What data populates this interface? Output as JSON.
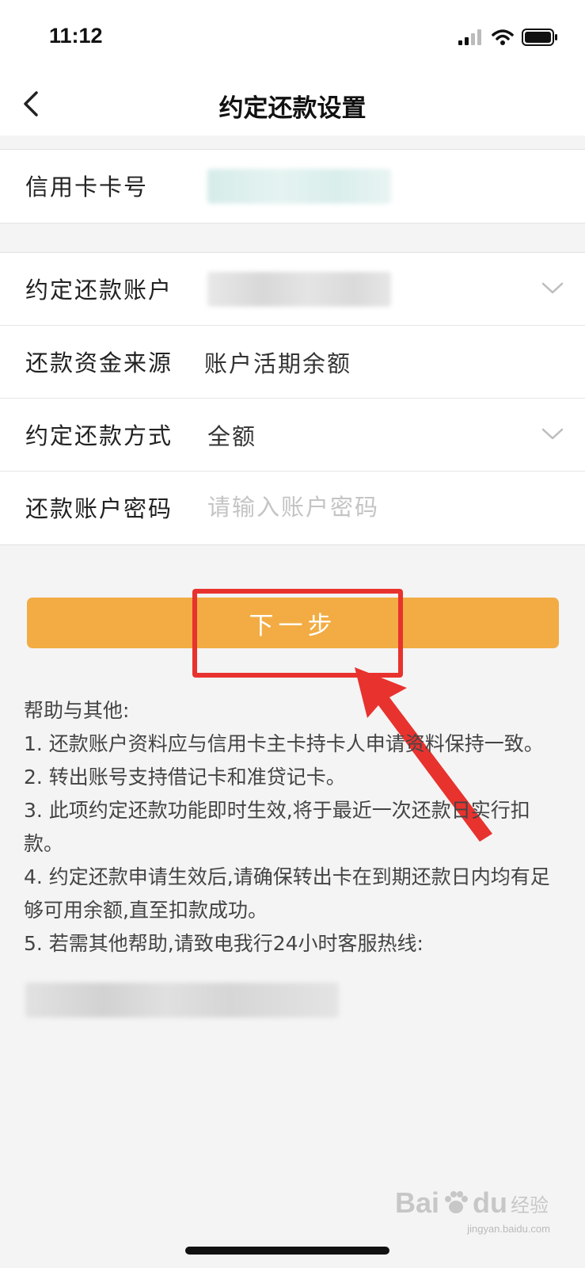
{
  "status_bar": {
    "time": "11:12"
  },
  "nav": {
    "title": "约定还款设置"
  },
  "card_section": {
    "card_number_label": "信用卡卡号"
  },
  "settings": {
    "account_label": "约定还款账户",
    "fund_source_label": "还款资金来源",
    "fund_source_value": "账户活期余额",
    "method_label": "约定还款方式",
    "method_value": "全额",
    "password_label": "还款账户密码",
    "password_placeholder": "请输入账户密码"
  },
  "next_button": {
    "label": "下一步"
  },
  "help": {
    "title": "帮助与其他:",
    "items": [
      "1. 还款账户资料应与信用卡主卡持卡人申请资料保持一致。",
      "2. 转出账号支持借记卡和准贷记卡。",
      "3. 此项约定还款功能即时生效,将于最近一次还款日实行扣款。",
      "4. 约定还款申请生效后,请确保转出卡在到期还款日内均有足够可用余额,直至扣款成功。",
      "5. 若需其他帮助,请致电我行24小时客服热线:"
    ]
  },
  "watermark": {
    "brand": "Bai",
    "brand2": "du",
    "cn": "经验",
    "url": "jingyan.baidu.com"
  },
  "colors": {
    "accent": "#f2ac43",
    "highlight": "#e8322e",
    "background": "#f4f4f4"
  },
  "icons": [
    "back-arrow-icon",
    "chevron-down-icon",
    "signal-icon",
    "wifi-icon",
    "battery-icon"
  ]
}
